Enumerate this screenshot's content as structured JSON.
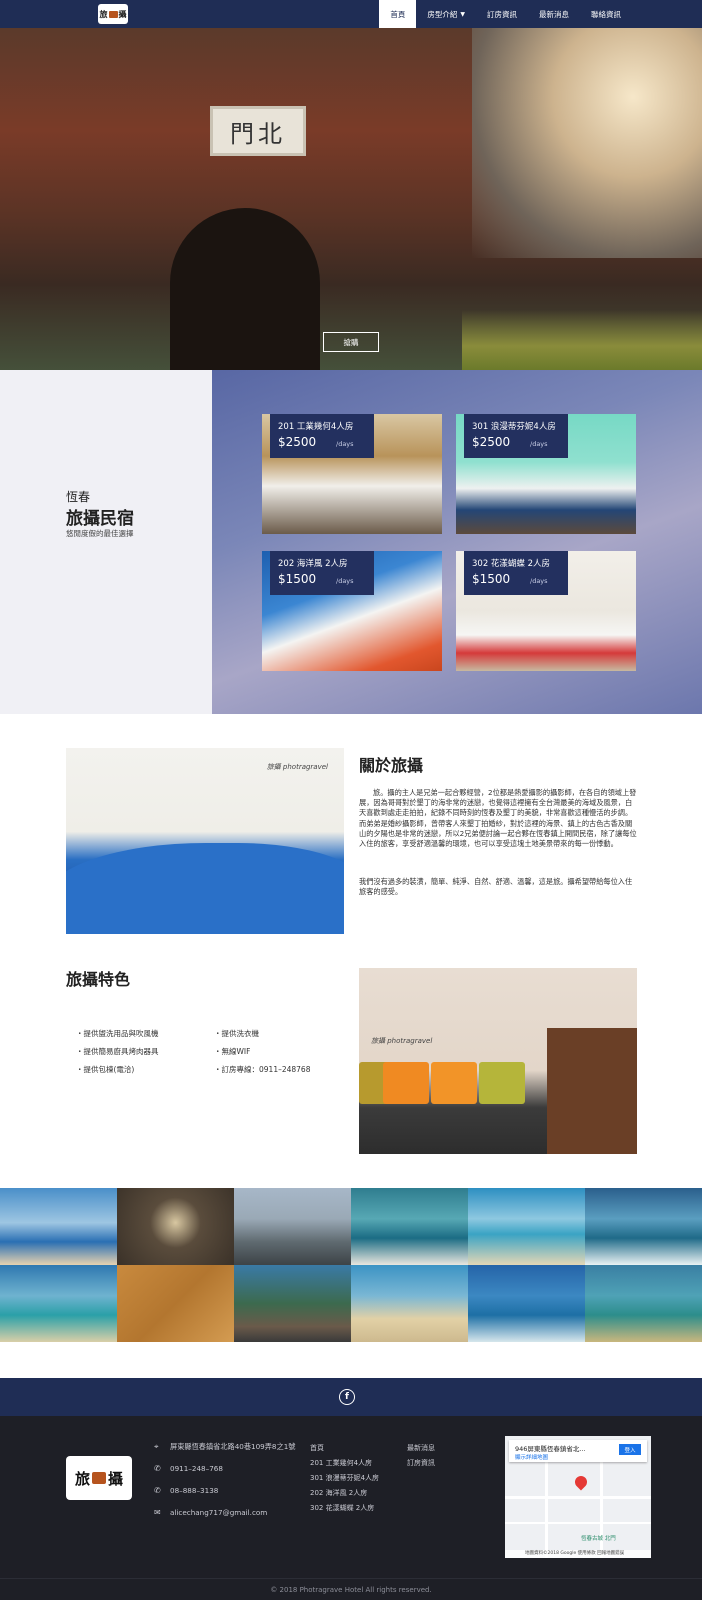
{
  "nav": {
    "logo_left": "旅",
    "logo_right": "攝",
    "items": [
      {
        "label": "首頁",
        "active": true
      },
      {
        "label": "房型介紹",
        "active": false,
        "dropdown": true
      },
      {
        "label": "訂房資訊",
        "active": false
      },
      {
        "label": "最新消息",
        "active": false
      },
      {
        "label": "聯絡資訊",
        "active": false
      }
    ]
  },
  "hero": {
    "plaque": "門北",
    "button": "搶購"
  },
  "rooms": {
    "subtitle": "恆春",
    "title": "旅攝民宿",
    "tagline": "悠閒度假的最佳選擇",
    "per_label": "/days",
    "items": [
      {
        "name": "201 工業幾何4人房",
        "price": "$2500"
      },
      {
        "name": "301 浪漫蒂芬妮4人房",
        "price": "$2500"
      },
      {
        "name": "202 海洋風 2人房",
        "price": "$1500"
      },
      {
        "name": "302 花漾蝴蝶 2人房",
        "price": "$1500"
      }
    ]
  },
  "about": {
    "image_brand": "旅攝 photragravel",
    "title": "關於旅攝",
    "p1": "旅。攝的主人是兄弟一起合夥經營，2位都是熱愛攝影的攝影師，在各自的領域上發展，因為哥哥對於墾丁的海非常的迷戀，也覺得這裡擁有全台灣最美的海域及風景，白天喜歡到處走走拍拍，紀錄不同時刻的恆春及墾丁的美貌，非常喜歡這種慢活的步調。而弟弟是婚紗攝影師，曾帶客人來墾丁拍婚紗，對於這裡的海景、鎮上的古色古香及關山的夕陽也是非常的迷戀，所以2兄弟便討論一起合夥在恆春鎮上開間民宿，除了讓每位入住的旅客，享受舒適溫馨的環境，也可以享受這塊土地美景帶來的每一份悸動。",
    "p2": "我們沒有過多的裝潢，簡單、純淨、自然、舒適、溫馨，這是旅。攝希望帶給每位入住旅客的感受。"
  },
  "features": {
    "title": "旅攝特色",
    "col1": [
      "・提供盥洗用品與吹風機",
      "・提供簡易廚具烤肉器具",
      "・提供包棟(電洽)"
    ],
    "col2": [
      "・提供洗衣機",
      "・無線WIF",
      "・訂房專線：0911–248768"
    ],
    "image_brand": "旅攝 photragravel"
  },
  "footer": {
    "fb_icon": "f",
    "logo_left": "旅",
    "logo_right": "攝",
    "address": "屏東縣恆春鎮省北路40巷109弄8之1號",
    "phone1": "0911–248–768",
    "phone2": "08–888–3138",
    "email": "alicechang717@gmail.com",
    "links_col1": [
      "首頁",
      "201 工業幾何4人房",
      "301 浪漫蒂芬妮4人房",
      "202 海洋風 2人房",
      "302 花漾蝴蝶 2人房"
    ],
    "links_col2": [
      "最新消息",
      "訂房資訊"
    ],
    "map": {
      "address": "946屏東縣恆春鎮省北...",
      "bigmap": "顯示詳細地圖",
      "login": "登入",
      "place": "恆春古城 北門",
      "credit": "地圖資料©2018 Google 使用條款 回報地圖錯誤"
    },
    "copyright": "© 2018 Photragrave Hotel All rights reserved."
  }
}
